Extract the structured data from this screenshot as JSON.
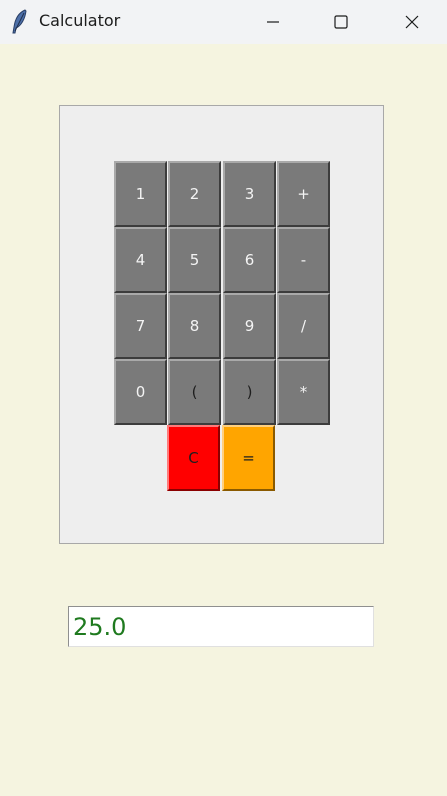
{
  "window": {
    "title": "Calculator",
    "icon": "feather-icon",
    "controls": [
      "minimize-icon",
      "maximize-icon",
      "close-icon"
    ]
  },
  "keypad": {
    "rows": [
      [
        "1",
        "2",
        "3",
        "+"
      ],
      [
        "4",
        "5",
        "6",
        "-"
      ],
      [
        "7",
        "8",
        "9",
        "/"
      ],
      [
        "0",
        "(",
        ")",
        "*"
      ],
      [
        "C",
        "="
      ]
    ]
  },
  "display": {
    "value": "25.0"
  },
  "colors": {
    "background": "#f5f4e0",
    "key": "#7a7a7a",
    "clear_key": "#ff0000",
    "equals_key": "#ffa500",
    "display_text": "#1f7a1f"
  }
}
